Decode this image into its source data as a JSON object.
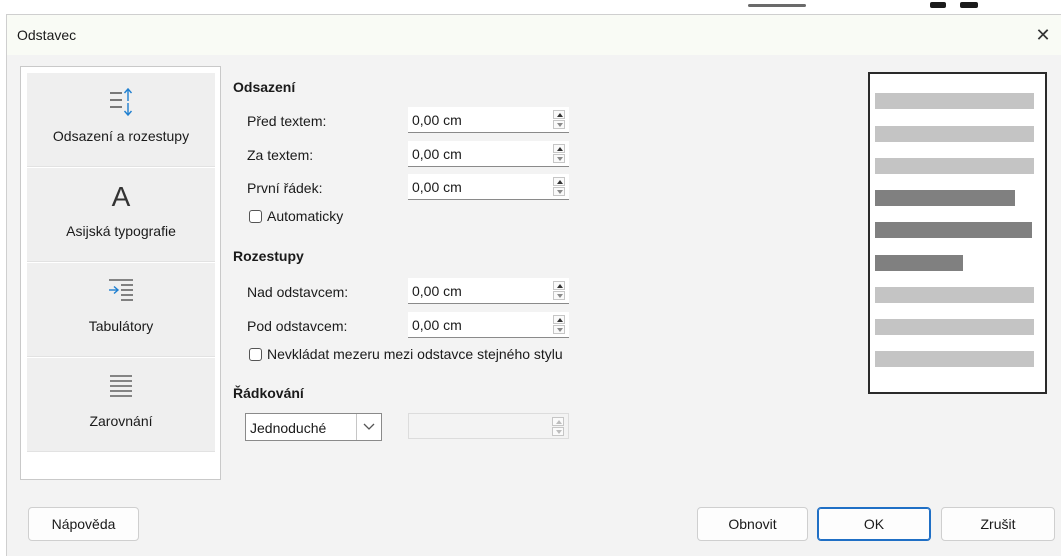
{
  "window": {
    "title": "Odstavec",
    "close_glyph": "✕"
  },
  "sidebar": {
    "items": [
      {
        "label": "Odsazení a rozestupy",
        "icon": "indent-spacing-icon"
      },
      {
        "label": "Asijská typografie",
        "icon": "asian-typography-icon",
        "glyph": "A"
      },
      {
        "label": "Tabulátory",
        "icon": "tabs-icon"
      },
      {
        "label": "Zarovnání",
        "icon": "alignment-icon"
      }
    ]
  },
  "indent": {
    "title": "Odsazení",
    "before_label": "Před textem:",
    "before_value": "0,00 cm",
    "after_label": "Za textem:",
    "after_value": "0,00 cm",
    "first_label": "První řádek:",
    "first_value": "0,00 cm",
    "auto_label": "Automaticky"
  },
  "spacing": {
    "title": "Rozestupy",
    "above_label": "Nad odstavcem:",
    "above_value": "0,00 cm",
    "below_label": "Pod odstavcem:",
    "below_value": "0,00 cm",
    "no_space_label": "Nevkládat mezeru mezi odstavce stejného stylu"
  },
  "line_spacing": {
    "title": "Řádkování",
    "selected": "Jednoduché",
    "value": ""
  },
  "buttons": {
    "help": "Nápověda",
    "reset": "Obnovit",
    "ok": "OK",
    "cancel": "Zrušit"
  },
  "colors": {
    "accent": "#1f6fc5",
    "preview_light": "#c4c4c4",
    "preview_dark": "#808080"
  }
}
